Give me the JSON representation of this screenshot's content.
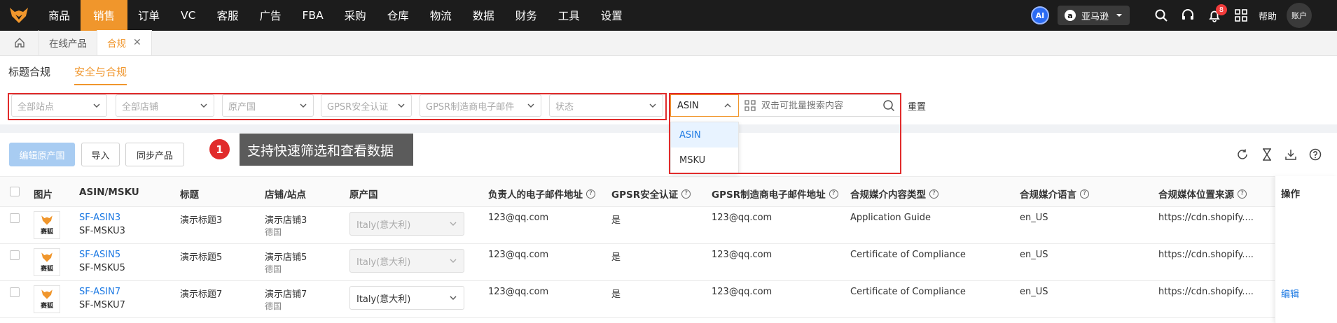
{
  "nav": {
    "items": [
      "商品",
      "销售",
      "订单",
      "VC",
      "客服",
      "广告",
      "FBA",
      "采购",
      "仓库",
      "物流",
      "数据",
      "财务",
      "工具",
      "设置"
    ],
    "active_index": 1,
    "ai_label": "AI",
    "marketplace": "亚马逊",
    "notification_count": "8",
    "help_label": "帮助",
    "account_label": "账户",
    "accent_color": "#f0962c"
  },
  "tabs": {
    "items": [
      {
        "label": "在线产品",
        "active": false
      },
      {
        "label": "合规",
        "active": true
      }
    ]
  },
  "subtabs": [
    "标题合规",
    "安全与合规"
  ],
  "filters": {
    "site": "全部站点",
    "store": "全部店铺",
    "origin": "原产国",
    "gpsr": "GPSR安全认证",
    "gpsr_email": "GPSR制造商电子邮件",
    "status": "状态",
    "search_type": "ASIN",
    "search_placeholder": "双击可批量搜索内容",
    "reset": "重置",
    "dropdown_options": [
      "ASIN",
      "MSKU"
    ]
  },
  "actions": {
    "edit_origin": "编辑原产国",
    "import": "导入",
    "sync": "同步产品"
  },
  "tooltip": {
    "number": "1",
    "text": "支持快速筛选和查看数据"
  },
  "table": {
    "headers": {
      "image": "图片",
      "asin_msku": "ASIN/MSKU",
      "title": "标题",
      "store_site": "店铺/站点",
      "origin": "原产国",
      "email": "负责人的电子邮件地址",
      "gpsr": "GPSR安全认证",
      "gpsr_email": "GPSR制造商电子邮件地址",
      "media_type": "合规媒介内容类型",
      "media_lang": "合规媒介语言",
      "media_source": "合规媒体位置来源",
      "ops": "操作"
    },
    "rows": [
      {
        "thumb_label": "赛狐",
        "asin": "SF-ASIN3",
        "msku": "SF-MSKU3",
        "title": "演示标题3",
        "store": "演示店铺3",
        "site": "德国",
        "origin": "Italy(意大利)",
        "origin_enabled": false,
        "email": "123@qq.com",
        "gpsr": "是",
        "gpsr_email": "123@qq.com",
        "media_type": "Application Guide",
        "media_lang": "en_US",
        "media_source": "https://cdn.shopify....",
        "op": ""
      },
      {
        "thumb_label": "赛狐",
        "asin": "SF-ASIN5",
        "msku": "SF-MSKU5",
        "title": "演示标题5",
        "store": "演示店铺5",
        "site": "德国",
        "origin": "Italy(意大利)",
        "origin_enabled": false,
        "email": "123@qq.com",
        "gpsr": "是",
        "gpsr_email": "123@qq.com",
        "media_type": "Certificate of Compliance",
        "media_lang": "en_US",
        "media_source": "https://cdn.shopify....",
        "op": ""
      },
      {
        "thumb_label": "赛狐",
        "asin": "SF-ASIN7",
        "msku": "SF-MSKU7",
        "title": "演示标题7",
        "store": "演示店铺7",
        "site": "德国",
        "origin": "Italy(意大利)",
        "origin_enabled": true,
        "email": "123@qq.com",
        "gpsr": "是",
        "gpsr_email": "123@qq.com",
        "media_type": "Certificate of Compliance",
        "media_lang": "en_US",
        "media_source": "https://cdn.shopify....",
        "op": "编辑"
      }
    ]
  }
}
